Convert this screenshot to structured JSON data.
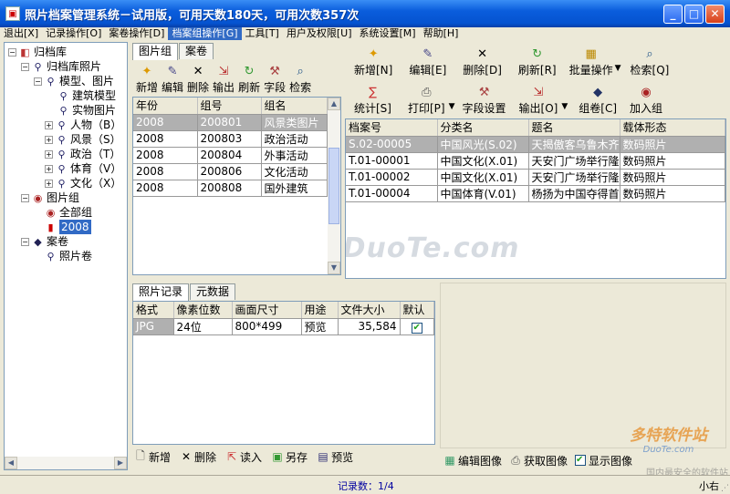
{
  "window": {
    "title": "照片档案管理系统－试用版，可用天数180天，可用次数357次"
  },
  "menu": [
    "退出[X]",
    "记录操作[O]",
    "案卷操作[D]",
    "档案组操作[G]",
    "工具[T]",
    "用户及权限[U]",
    "系统设置[M]",
    "帮助[H]"
  ],
  "tree": {
    "root": "归档库",
    "archive_photos": "归档库照片",
    "model_photos": "模型、图片",
    "building_model": "建筑模型",
    "object_photos": "实物图片",
    "person": "人物（B）",
    "scenery": "风景（S）",
    "politics": "政治（T）",
    "sports": "体育（V）",
    "culture": "文化（X）",
    "photo_group": "图片组",
    "all_groups": "全部组",
    "group_2008": "2008",
    "volume": "案卷",
    "photo_volume": "照片卷"
  },
  "group_panel": {
    "tabs": [
      "图片组",
      "案卷"
    ],
    "toolbar": [
      "新增",
      "编辑",
      "删除",
      "输出",
      "刷新",
      "字段",
      "检索"
    ],
    "columns": [
      "年份",
      "组号",
      "组名"
    ],
    "rows": [
      [
        "2008",
        "200801",
        "风景类图片"
      ],
      [
        "2008",
        "200803",
        "政治活动"
      ],
      [
        "2008",
        "200804",
        "外事活动"
      ],
      [
        "2008",
        "200806",
        "文化活动"
      ],
      [
        "2008",
        "200808",
        "国外建筑"
      ]
    ]
  },
  "record_toolbar": {
    "row1": [
      "新增[N]",
      "编辑[E]",
      "删除[D]",
      "刷新[R]",
      "批量操作",
      "检索[Q]"
    ],
    "row2": [
      "统计[S]",
      "打印[P]",
      "字段设置",
      "输出[O]",
      "组卷[C]",
      "加入组"
    ]
  },
  "record_table": {
    "columns": [
      "档案号",
      "分类名",
      "题名",
      "载体形态"
    ],
    "rows": [
      [
        "S.02-00005",
        "中国风光(S.02)",
        "天揭傲客乌鲁木齐",
        "数码照片"
      ],
      [
        "T.01-00001",
        "中国文化(X.01)",
        "天安门广场举行隆",
        "数码照片"
      ],
      [
        "T.01-00002",
        "中国文化(X.01)",
        "天安门广场举行隆",
        "数码照片"
      ],
      [
        "T.01-00004",
        "中国体育(V.01)",
        "杨扬为中国夺得首",
        "数码照片"
      ]
    ]
  },
  "photo_panel": {
    "tabs": [
      "照片记录",
      "元数据"
    ],
    "columns": [
      "格式",
      "像素位数",
      "画面尺寸",
      "用途",
      "文件大小",
      "默认"
    ],
    "rows": [
      [
        "JPG",
        "24位",
        "800*499",
        "预览",
        "35,584"
      ]
    ],
    "buttons": [
      "新增",
      "删除",
      "读入",
      "另存",
      "预览"
    ]
  },
  "image_panel": {
    "buttons": [
      "编辑图像",
      "获取图像"
    ],
    "show_image_label": "显示图像",
    "zoom_label": "小右"
  },
  "status": {
    "record_count": "记录数：1/4"
  },
  "watermarks": {
    "main": "www.DuoTe.com",
    "logo": "多特软件站",
    "logo_url": "DuoTe.com",
    "logo_sub": "国内最安全的软件站"
  }
}
